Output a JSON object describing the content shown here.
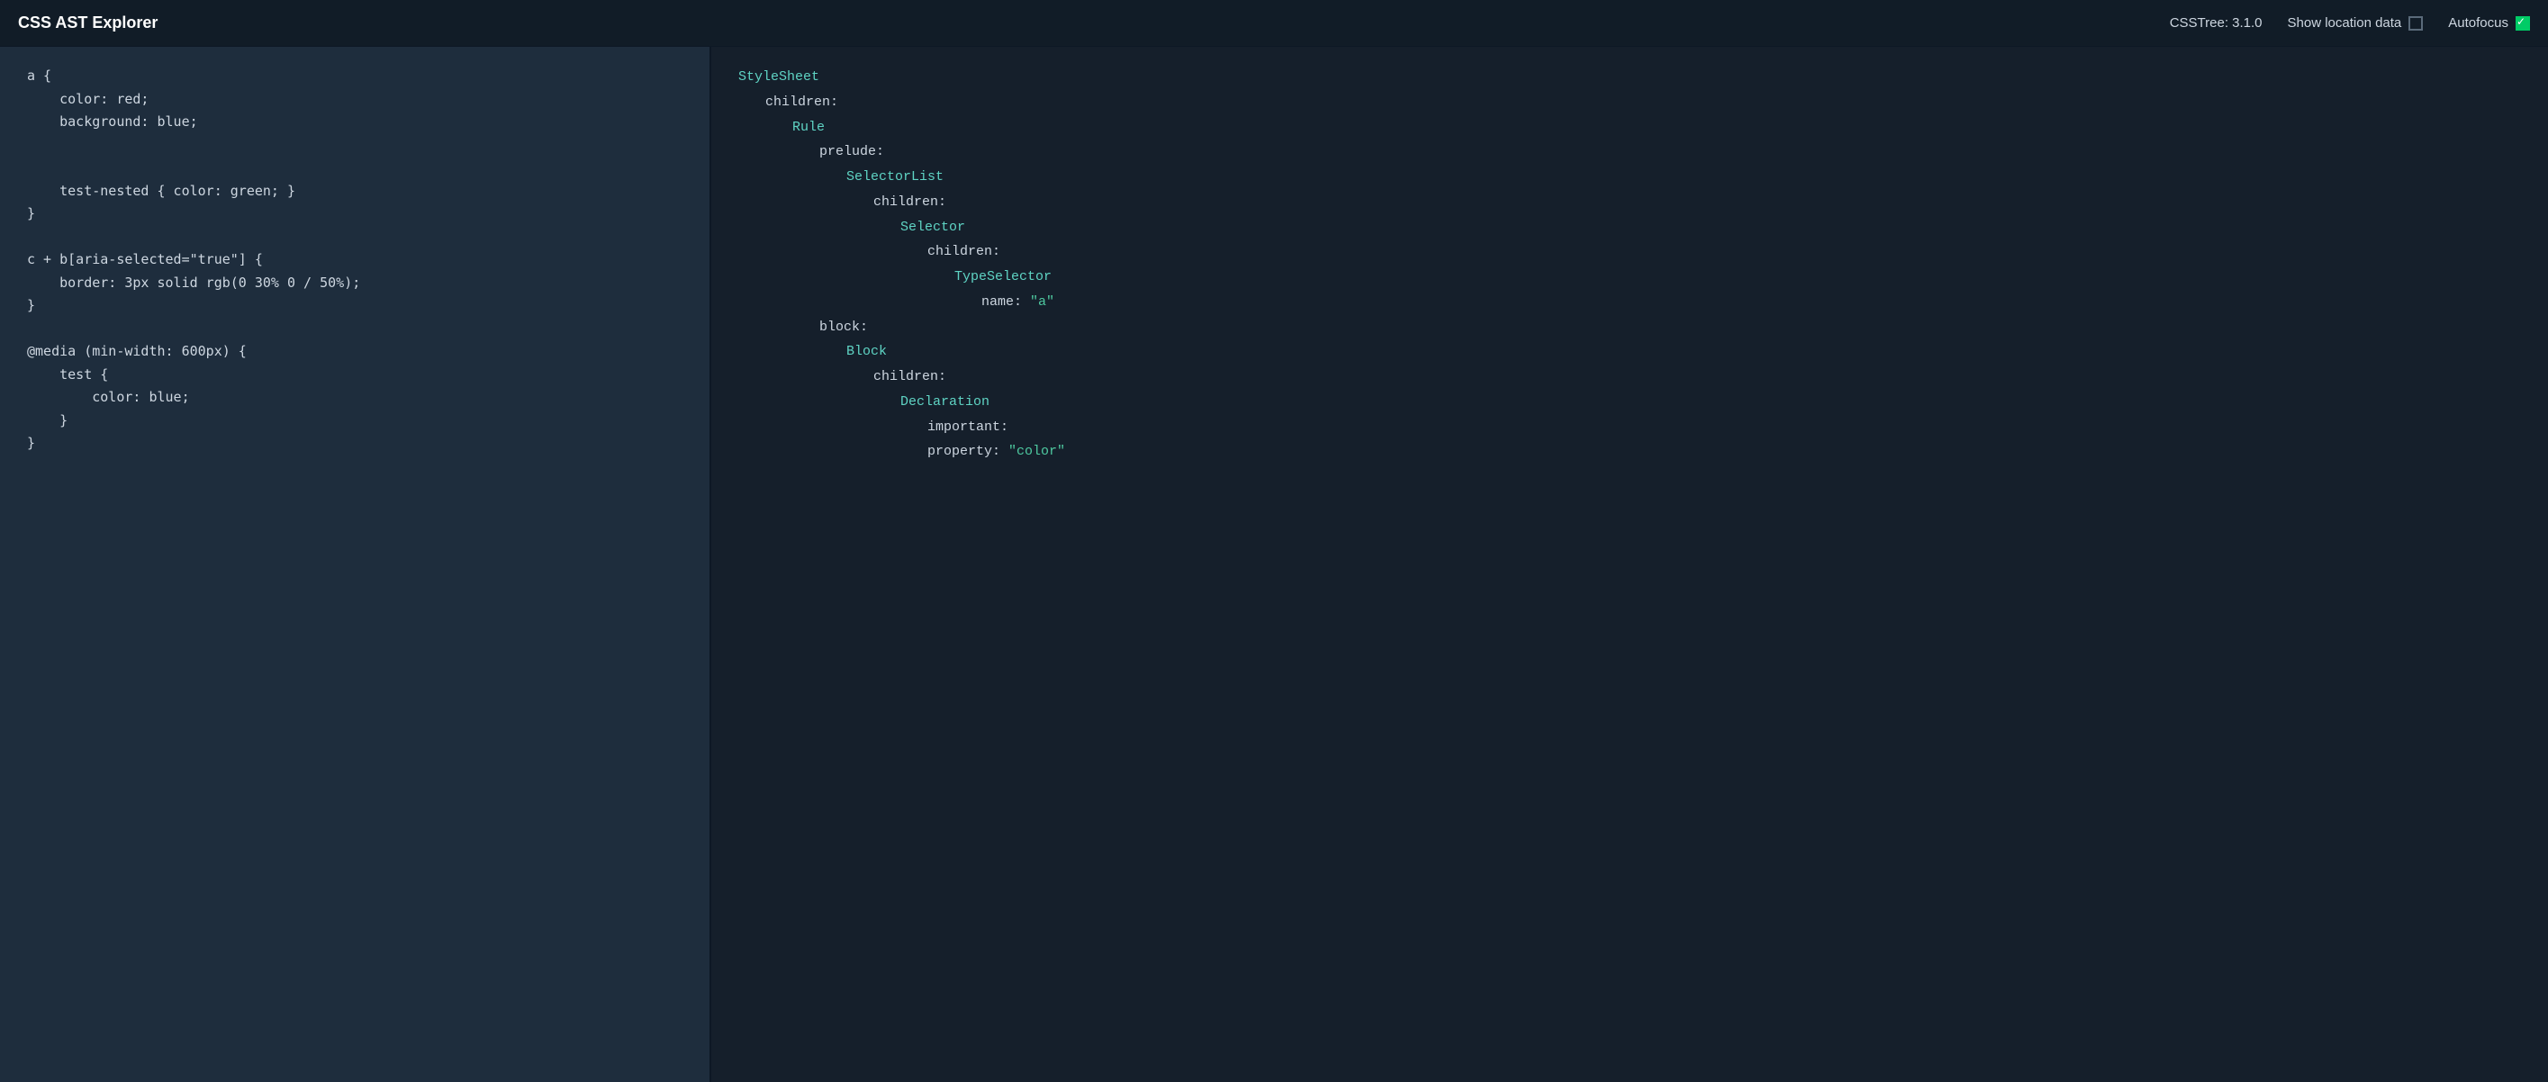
{
  "header": {
    "title": "CSS AST Explorer",
    "version_label": "CSSTree: 3.1.0",
    "show_location_label": "Show location data",
    "autofocus_label": "Autofocus",
    "show_location_checked": false,
    "autofocus_checked": true
  },
  "editor": {
    "code": "a {\n    color: red;\n    background: blue;\n\n\n    test-nested { color: green; }\n}\n\nc + b[aria-selected=\"true\"] {\n    border: 3px solid rgb(0 30% 0 / 50%);\n}\n\n@media (min-width: 600px) {\n    test {\n        color: blue;\n    }\n}"
  },
  "ast": {
    "lines": [
      {
        "indent": 0,
        "type": "node",
        "node_type": "StyleSheet",
        "text": null
      },
      {
        "indent": 1,
        "type": "key",
        "key": "children:",
        "text": null
      },
      {
        "indent": 2,
        "type": "node",
        "node_type": "Rule",
        "text": null
      },
      {
        "indent": 3,
        "type": "key",
        "key": "prelude:",
        "text": null
      },
      {
        "indent": 4,
        "type": "node",
        "node_type": "SelectorList",
        "text": null
      },
      {
        "indent": 5,
        "type": "key",
        "key": "children:",
        "text": null
      },
      {
        "indent": 6,
        "type": "node",
        "node_type": "Selector",
        "text": null
      },
      {
        "indent": 7,
        "type": "key",
        "key": "children:",
        "text": null
      },
      {
        "indent": 8,
        "type": "node",
        "node_type": "TypeSelector",
        "text": null
      },
      {
        "indent": 9,
        "type": "keyval",
        "key": "name:",
        "val": "\"a\""
      },
      {
        "indent": 3,
        "type": "key",
        "key": "block:",
        "text": null
      },
      {
        "indent": 4,
        "type": "node",
        "node_type": "Block",
        "text": null
      },
      {
        "indent": 5,
        "type": "key",
        "key": "children:",
        "text": null
      },
      {
        "indent": 6,
        "type": "node",
        "node_type": "Declaration",
        "text": null
      },
      {
        "indent": 7,
        "type": "key",
        "key": "important:",
        "text": null
      },
      {
        "indent": 7,
        "type": "keyval",
        "key": "property:",
        "val": "\"color\""
      }
    ]
  },
  "colors": {
    "node_type": "#5fd4c4",
    "key": "#cdd6e0",
    "string": "#4ec9a0",
    "header_bg": "#111c27",
    "editor_bg": "#1e2d3d",
    "ast_bg": "#151f2b"
  }
}
